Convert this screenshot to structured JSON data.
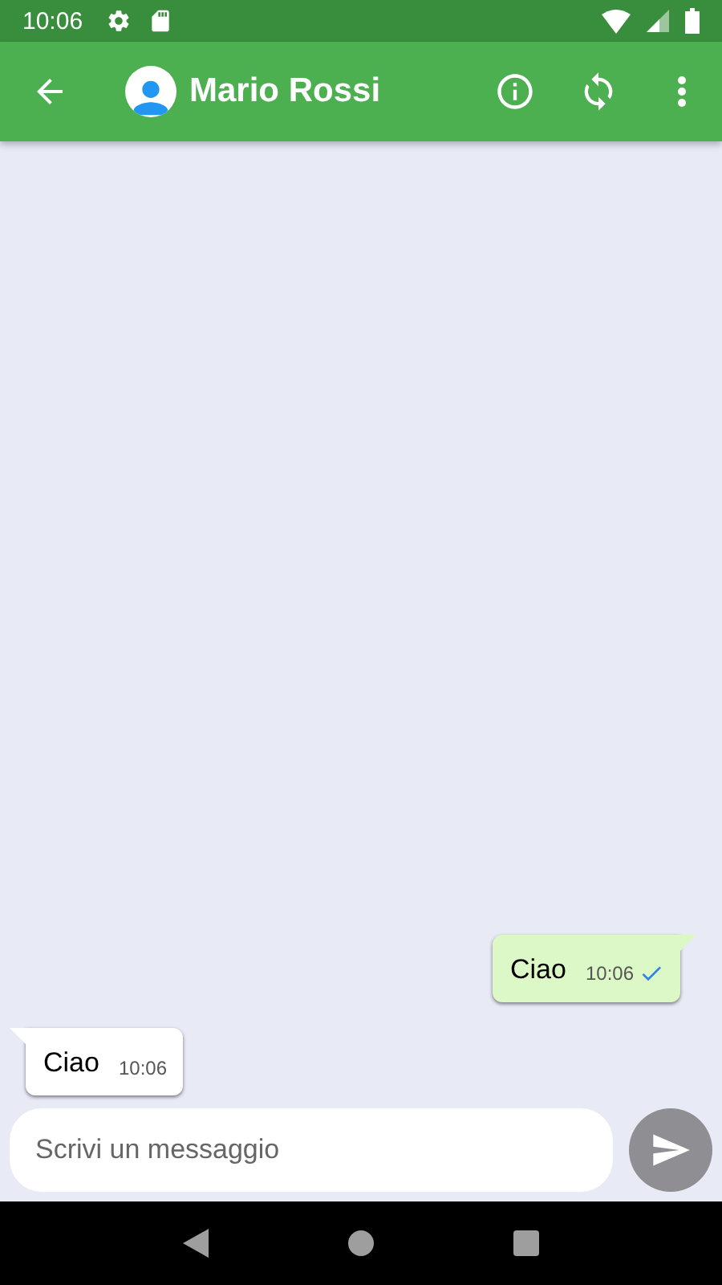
{
  "status_bar": {
    "time": "10:06"
  },
  "app_bar": {
    "title": "Mario Rossi"
  },
  "messages": [
    {
      "kind": "sent",
      "text": "Ciao",
      "time": "10:06",
      "delivered": true
    },
    {
      "kind": "received",
      "text": "Ciao",
      "time": "10:06",
      "delivered": false
    }
  ],
  "composer": {
    "placeholder": "Scrivi un messaggio"
  }
}
